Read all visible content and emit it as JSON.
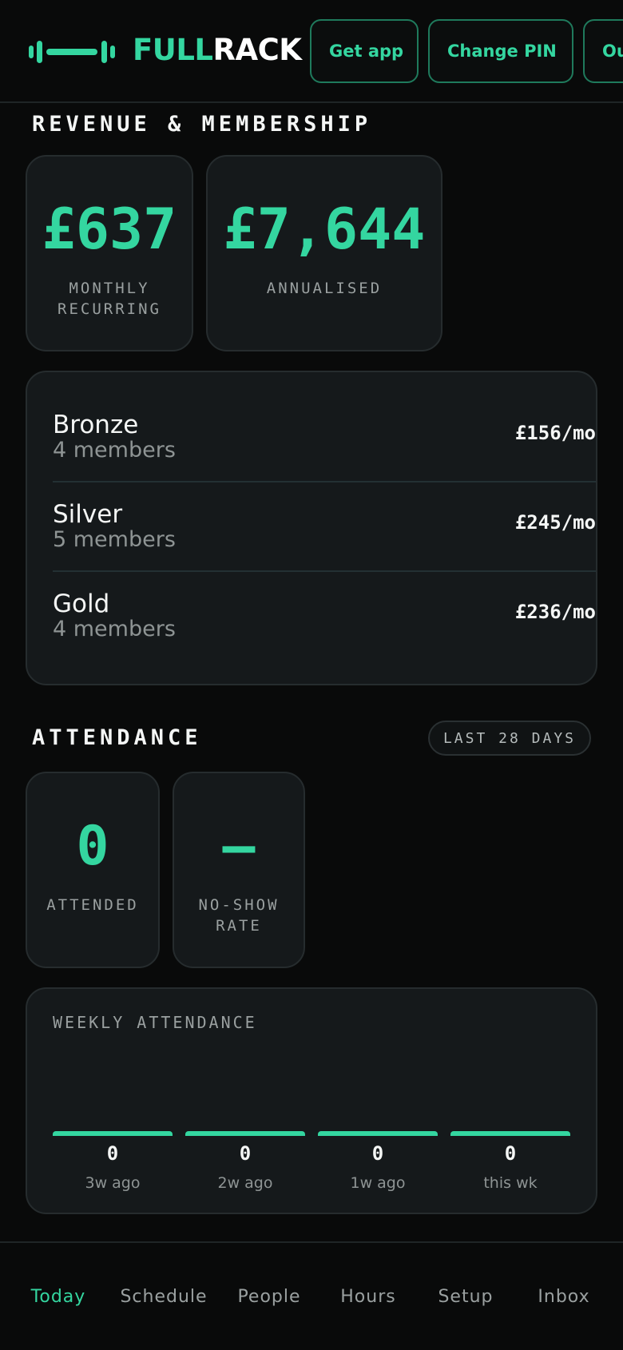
{
  "brand": {
    "part1": "FULL",
    "part2": "RACK",
    "logo_icon": "barbell-icon"
  },
  "header": {
    "buttons": [
      {
        "label": "Get app"
      },
      {
        "label": "Change PIN"
      },
      {
        "label": "Ou"
      }
    ]
  },
  "revenue": {
    "title": "REVENUE & MEMBERSHIP",
    "monthly": {
      "value": "£637",
      "label": "MONTHLY\nRECURRING"
    },
    "annual": {
      "value": "£7,644",
      "label": "ANNUALISED"
    },
    "tiers": [
      {
        "name": "Bronze",
        "members": "4 members",
        "price": "£156/mo"
      },
      {
        "name": "Silver",
        "members": "5 members",
        "price": "£245/mo"
      },
      {
        "name": "Gold",
        "members": "4 members",
        "price": "£236/mo"
      }
    ]
  },
  "attendance": {
    "title": "ATTENDANCE",
    "period": "LAST 28 DAYS",
    "attended": {
      "value": "0",
      "label": "ATTENDED"
    },
    "noshow": {
      "value": "—",
      "label": "NO-SHOW\nRATE"
    },
    "chart_title": "WEEKLY ATTENDANCE"
  },
  "chart_data": {
    "type": "bar",
    "title": "WEEKLY ATTENDANCE",
    "categories": [
      "3w ago",
      "2w ago",
      "1w ago",
      "this wk"
    ],
    "values": [
      0,
      0,
      0,
      0
    ],
    "value_labels": [
      "0",
      "0",
      "0",
      "0"
    ]
  },
  "nav": {
    "items": [
      {
        "label": "Today",
        "active": true
      },
      {
        "label": "Schedule"
      },
      {
        "label": "People"
      },
      {
        "label": "Hours"
      },
      {
        "label": "Setup"
      },
      {
        "label": "Inbox"
      }
    ]
  },
  "colors": {
    "accent": "#34d6a0",
    "background": "#090a0a",
    "card": "#15191b"
  }
}
